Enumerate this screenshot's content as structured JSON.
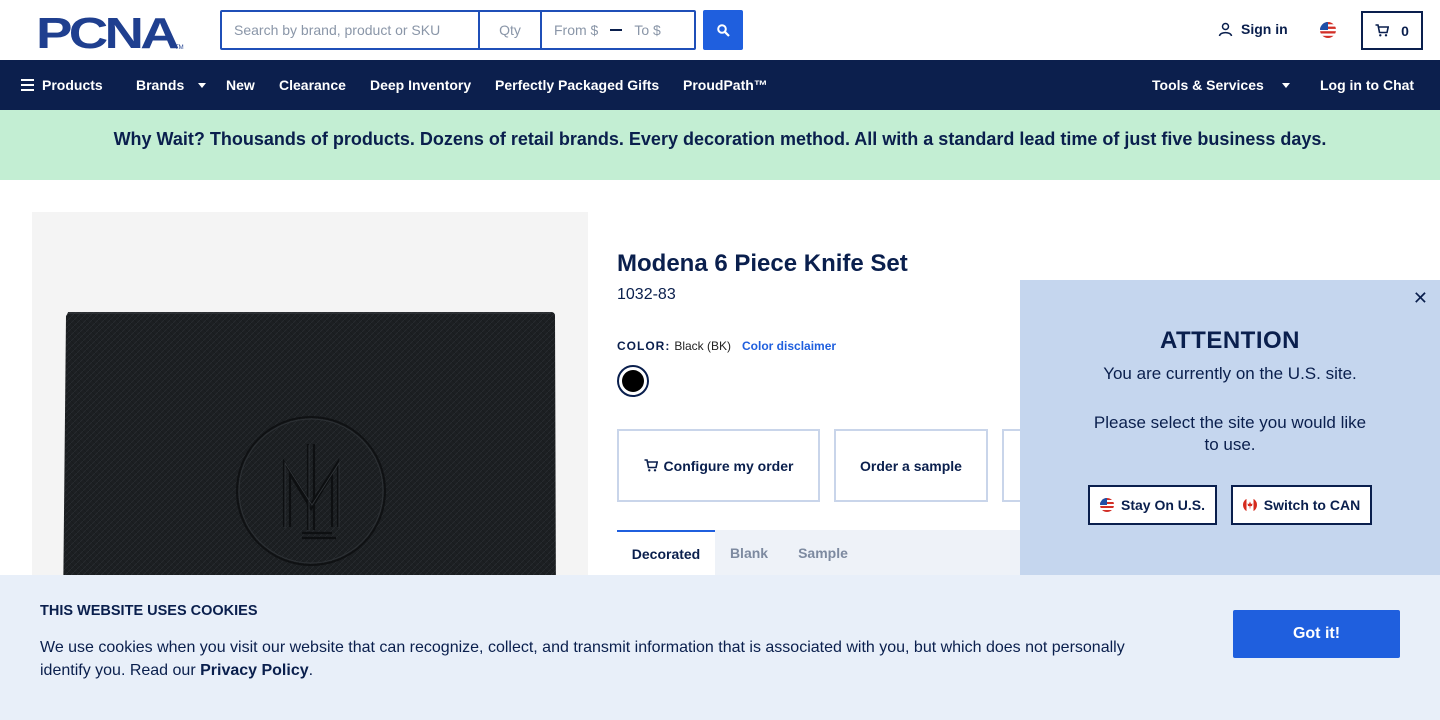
{
  "header": {
    "logo_text": "PCNA",
    "search_placeholder": "Search by brand, product or SKU",
    "qty_placeholder": "Qty",
    "price_from_placeholder": "From $",
    "price_to_placeholder": "To $",
    "signin_label": "Sign in",
    "cart_count": "0"
  },
  "nav": {
    "products": "Products",
    "brands": "Brands",
    "new": "New",
    "clearance": "Clearance",
    "deep_inventory": "Deep Inventory",
    "gifts": "Perfectly Packaged Gifts",
    "proudpath": "ProudPath™",
    "tools": "Tools & Services",
    "chat": "Log in to Chat"
  },
  "banner": {
    "text": "Why Wait? Thousands of products. Dozens of retail brands. Every decoration method. All with a standard lead time of just five business days."
  },
  "product": {
    "title": "Modena 6 Piece Knife Set",
    "sku": "1032-83",
    "color_label": "COLOR:",
    "color_value": "Black (BK)",
    "color_disclaimer": "Color disclaimer",
    "swatch_color": "#000000",
    "configure_label": "Configure my order",
    "sample_label": "Order a sample",
    "tabs": [
      "Decorated",
      "Blank",
      "Sample"
    ]
  },
  "attention": {
    "title": "ATTENTION",
    "message1": "You are currently on the U.S. site.",
    "message2": "Please select the site you would like to use.",
    "stay_label": "Stay On U.S.",
    "switch_label": "Switch to CAN"
  },
  "cookie": {
    "title": "THIS WEBSITE USES COOKIES",
    "text_before": "We use cookies when you visit our website that can recognize, collect, and transmit information that is associated with you, but which does not personally identify you. Read our ",
    "link_text": "Privacy Policy",
    "text_after": ".",
    "button_label": "Got it!"
  },
  "colors": {
    "navy": "#0c1f4d",
    "accent_blue": "#1f5fde",
    "banner_green": "#c3eed3",
    "popup_blue": "#c5d6ee",
    "cookie_bg": "#e8eff9"
  }
}
